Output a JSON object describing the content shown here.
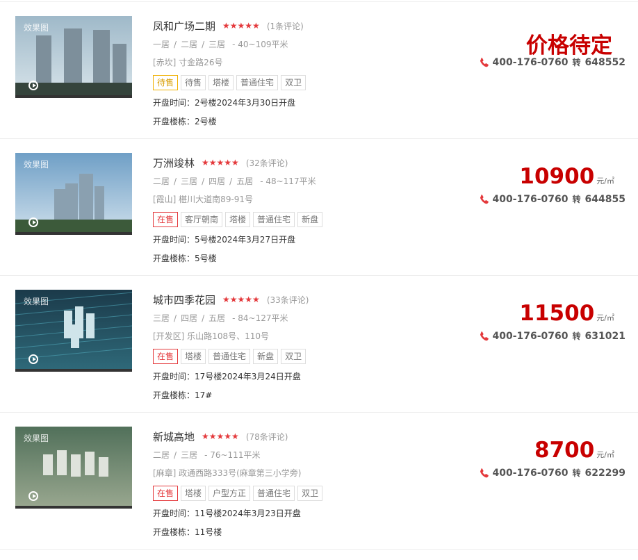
{
  "listings": [
    {
      "thumb_tag": "效果图",
      "name": "凤和广场二期",
      "stars": "★★★★★",
      "reviews": "(1条评论)",
      "layouts": [
        "一居",
        "二居",
        "三居"
      ],
      "area": "- 40~109平米",
      "address": "[赤坎] 寸金路26号",
      "tags": [
        "待售",
        "待售",
        "塔楼",
        "普通住宅",
        "双卫"
      ],
      "open_time": "开盘时间：2号楼2024年3月30日开盘",
      "open_bldg": "开盘楼栋：2号楼",
      "price_text": "价格待定",
      "price_unit": "",
      "phone": "400-176-0760",
      "ext_label": "转",
      "ext": "648552",
      "thumb_style": "towers"
    },
    {
      "thumb_tag": "效果图",
      "name": "万洲竣林",
      "stars": "★★★★★",
      "reviews": "(32条评论)",
      "layouts": [
        "二居",
        "三居",
        "四居",
        "五居"
      ],
      "area": "- 48~117平米",
      "address": "[霞山] 椹川大道南89-91号",
      "tags": [
        "在售",
        "客厅朝南",
        "塔楼",
        "普通住宅",
        "新盘"
      ],
      "open_time": "开盘时间：5号楼2024年3月27日开盘",
      "open_bldg": "开盘楼栋：5号楼",
      "price_text": "10900",
      "price_unit": "元/㎡",
      "phone": "400-176-0760",
      "ext_label": "转",
      "ext": "644855",
      "thumb_style": "sky"
    },
    {
      "thumb_tag": "效果图",
      "name": "城市四季花园",
      "stars": "★★★★★",
      "reviews": "(33条评论)",
      "layouts": [
        "三居",
        "四居",
        "五居"
      ],
      "area": "- 84~127平米",
      "address": "[开发区] 乐山路108号、110号",
      "tags": [
        "在售",
        "塔楼",
        "普通住宅",
        "新盘",
        "双卫"
      ],
      "open_time": "开盘时间：17号楼2024年3月24日开盘",
      "open_bldg": "开盘楼栋：17#",
      "price_text": "11500",
      "price_unit": "元/㎡",
      "phone": "400-176-0760",
      "ext_label": "转",
      "ext": "631021",
      "thumb_style": "aerial"
    },
    {
      "thumb_tag": "效果图",
      "name": "新城高地",
      "stars": "★★★★★",
      "reviews": "(78条评论)",
      "layouts": [
        "二居",
        "三居"
      ],
      "area": "- 76~111平米",
      "address": "[麻章] 政通西路333号(麻章第三小学旁)",
      "tags": [
        "在售",
        "塔楼",
        "户型方正",
        "普通住宅",
        "双卫"
      ],
      "open_time": "开盘时间：11号楼2024年3月23日开盘",
      "open_bldg": "开盘楼栋：11号楼",
      "price_text": "8700",
      "price_unit": "元/㎡",
      "phone": "400-176-0760",
      "ext_label": "转",
      "ext": "622299",
      "thumb_style": "green"
    }
  ],
  "colors": {
    "price": "#c80000",
    "star": "#e4393c",
    "pending": "#d89c00"
  },
  "icons": {
    "phone": "phone-icon",
    "play": "play-icon"
  }
}
